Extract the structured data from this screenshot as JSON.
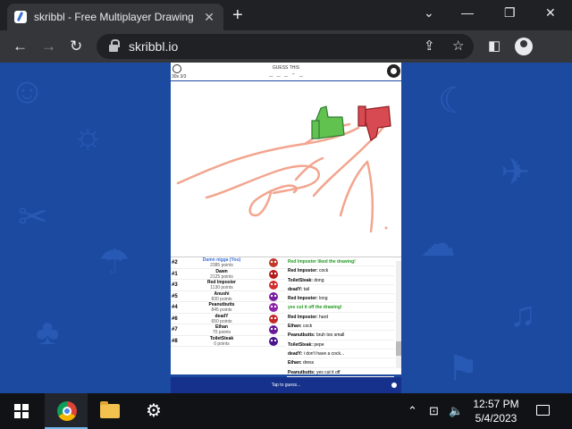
{
  "browser": {
    "tab_title": "skribbl - Free Multiplayer Drawing",
    "tab_close": "✕",
    "new_tab": "+",
    "url": "skribbl.io",
    "window_controls": {
      "minimize": "⌄",
      "restore": "—",
      "maximize": "❐",
      "close": "✕"
    },
    "nav": {
      "back": "←",
      "forward": "→",
      "reload": "↻"
    },
    "omni_icons": {
      "share": "⇪",
      "bookmark": "☆",
      "sidepanel": "◧"
    }
  },
  "game": {
    "round": "30s 3/3",
    "guess_label": "GUESS THIS",
    "hint": "_ _ _ - _",
    "players": [
      {
        "rank": "#2",
        "name": "Damn nigga (You)",
        "points": "2385 points",
        "avatar_color": "#c0392b",
        "me": true
      },
      {
        "rank": "#1",
        "name": "Dawn",
        "points": "2125 points",
        "avatar_color": "#b71c1c"
      },
      {
        "rank": "#3",
        "name": "Red Imposter",
        "points": "1130 points",
        "avatar_color": "#d32f2f"
      },
      {
        "rank": "#5",
        "name": "Anushi",
        "points": "830 points",
        "avatar_color": "#7b1fa2"
      },
      {
        "rank": "#4",
        "name": "Peanutbutts",
        "points": "845 points",
        "avatar_color": "#8e24aa"
      },
      {
        "rank": "#6",
        "name": "deadY",
        "points": "650 points",
        "avatar_color": "#c62828"
      },
      {
        "rank": "#7",
        "name": "Ethan",
        "points": "70 points",
        "avatar_color": "#6a1b9a"
      },
      {
        "rank": "#8",
        "name": "ToiletSteak",
        "points": "0 points",
        "avatar_color": "#4a148c"
      }
    ],
    "chat": [
      {
        "text": "Red Imposter liked the drawing!",
        "type": "green"
      },
      {
        "user": "Red Imposter:",
        "text": "cock"
      },
      {
        "user": "ToiletSteak:",
        "text": "dong"
      },
      {
        "user": "deadY:",
        "text": "tail"
      },
      {
        "user": "Red Imposter:",
        "text": "long"
      },
      {
        "user": "",
        "text": "yes cut it off the drawing!",
        "type": "green"
      },
      {
        "user": "Red Imposter:",
        "text": "hard"
      },
      {
        "user": "Ethan:",
        "text": "cock"
      },
      {
        "user": "Peanutbutts:",
        "text": "bruh too small"
      },
      {
        "user": "ToiletSteak:",
        "text": "pepe"
      },
      {
        "user": "deadY:",
        "text": "i don't have a cock..."
      },
      {
        "user": "Ethan:",
        "text": "dress"
      },
      {
        "user": "Peanutbutts:",
        "text": "yes cut it off"
      }
    ],
    "tap_to_guess": "Tap to guess..."
  },
  "taskbar": {
    "time": "12:57 PM",
    "date": "5/4/2023",
    "tray": {
      "chevron": "⌃",
      "network": "⊡",
      "volume": "🔈"
    }
  },
  "colors": {
    "accent": "#3b6fd8",
    "background": "#1c4aa0",
    "stroke": "#f2a58f"
  }
}
